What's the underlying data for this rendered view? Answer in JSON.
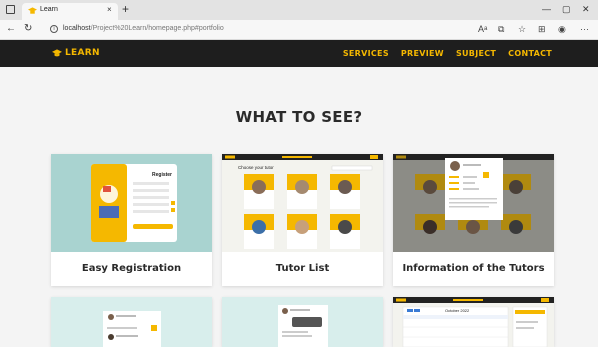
{
  "browser": {
    "tab_title": "Learn",
    "tab_close": "×",
    "new_tab": "+",
    "url_host": "localhost",
    "url_path": "/Project%20Learn/homepage.php#portfolio",
    "window_controls": [
      "—",
      "▢",
      "✕"
    ],
    "icons": [
      "read-aloud-icon",
      "extensions-icon",
      "favorites-icon",
      "collections-icon",
      "profile-icon",
      "more-icon"
    ]
  },
  "site": {
    "logo_text": "LEARN",
    "menu": [
      "SERVICES",
      "PREVIEW",
      "SUBJECT",
      "CONTACT"
    ],
    "brand_color": "#f5b800",
    "nav_bg": "#1e1e1e"
  },
  "main": {
    "section_title": "WHAT TO SEE?",
    "cards": [
      {
        "caption": "Easy Registration"
      },
      {
        "caption": "Tutor List"
      },
      {
        "caption": "Information of the Tutors"
      }
    ]
  },
  "thumb_text": {
    "register_title": "Register",
    "choose_tutor": "Choose your tutor",
    "calendar_month": "October 2022"
  }
}
